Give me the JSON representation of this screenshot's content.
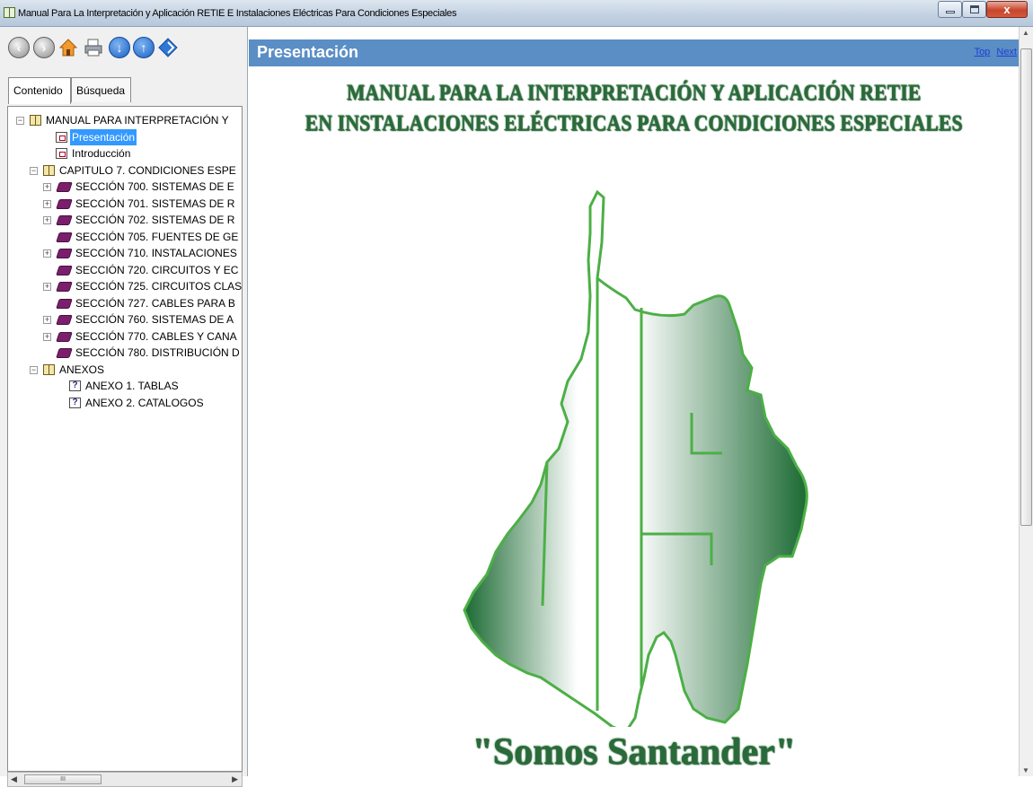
{
  "window": {
    "title": "Manual Para La Interpretación y Aplicación RETIE E Instalaciones Eléctricas Para Condiciones Especiales"
  },
  "toolbar": {
    "icons": [
      "back-icon",
      "forward-icon",
      "home-icon",
      "print-icon",
      "down-icon",
      "up-icon",
      "options-icon"
    ]
  },
  "tabs": {
    "contents": "Contenido",
    "search": "Búsqueda"
  },
  "tree": {
    "root": "MANUAL PARA INTERPRETACIÓN Y",
    "presentacion": "Presentación",
    "introduccion": "Introducción",
    "capitulo": "CAPITULO 7. CONDICIONES ESPE",
    "sections": [
      {
        "label": "SECCIÓN 700. SISTEMAS DE E",
        "expandable": true
      },
      {
        "label": "SECCIÓN 701. SISTEMAS DE R",
        "expandable": true
      },
      {
        "label": "SECCIÓN 702. SISTEMAS DE R",
        "expandable": true
      },
      {
        "label": "SECCIÓN 705. FUENTES DE GE",
        "expandable": false
      },
      {
        "label": "SECCIÓN 710. INSTALACIONES",
        "expandable": true
      },
      {
        "label": "SECCIÓN 720. CIRCUITOS Y EC",
        "expandable": false
      },
      {
        "label": "SECCIÓN 725. CIRCUITOS CLAS",
        "expandable": true
      },
      {
        "label": "SECCIÓN 727. CABLES PARA B",
        "expandable": false
      },
      {
        "label": "SECCIÓN 760. SISTEMAS DE A",
        "expandable": true
      },
      {
        "label": "SECCIÓN 770. CABLES Y CANA",
        "expandable": true
      },
      {
        "label": "SECCIÓN 780. DISTRIBUCIÓN D",
        "expandable": false
      }
    ],
    "anexos": "ANEXOS",
    "anexo1": "ANEXO 1. TABLAS",
    "anexo2": "ANEXO 2. CATALOGOS"
  },
  "hscroll": {
    "grip": "III"
  },
  "page": {
    "heading": "Presentación",
    "top_link": "Top",
    "next_link": "Next",
    "banner_line1": "MANUAL PARA LA INTERPRETACIÓN Y APLICACIÓN RETIE",
    "banner_line2": "EN INSTALACIONES ELÉCTRICAS PARA CONDICIONES ESPECIALES",
    "motto": "\"Somos Santander\""
  },
  "colors": {
    "header_bar": "#5a8ec5",
    "map_green": "#1b6a33",
    "selected": "#3399ff"
  }
}
